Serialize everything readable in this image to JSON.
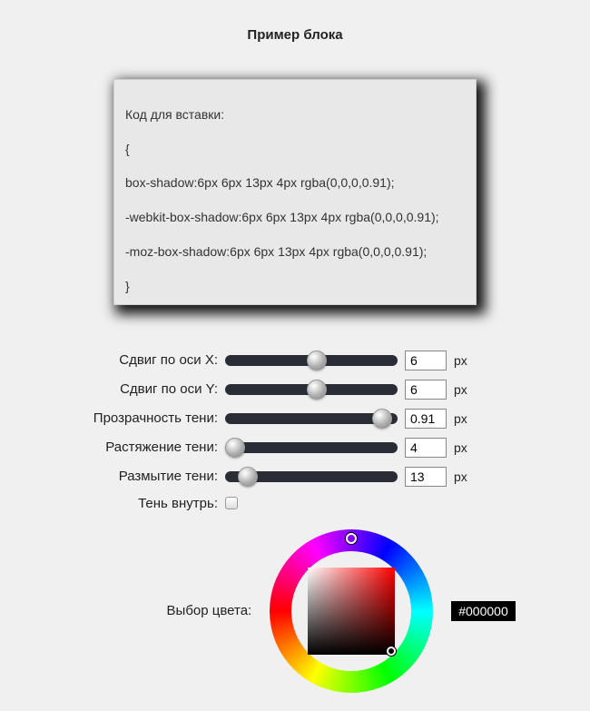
{
  "title": "Пример блока",
  "code": {
    "heading": "Код для вставки:",
    "open_brace": "{",
    "line1": "box-shadow:6px 6px 13px 4px rgba(0,0,0,0.91);",
    "line2": "-webkit-box-shadow:6px 6px 13px 4px rgba(0,0,0,0.91);",
    "line3": "-moz-box-shadow:6px 6px 13px 4px rgba(0,0,0,0.91);",
    "close_brace": "}"
  },
  "sliders": {
    "offset_x": {
      "label": "Сдвиг по оси X:",
      "value": "6",
      "unit": "px",
      "pct": 53
    },
    "offset_y": {
      "label": "Сдвиг по оси Y:",
      "value": "6",
      "unit": "px",
      "pct": 53
    },
    "opacity": {
      "label": "Прозрачность тени:",
      "value": "0.91",
      "unit": "px",
      "pct": 91
    },
    "spread": {
      "label": "Растяжение тени:",
      "value": "4",
      "unit": "px",
      "pct": 6
    },
    "blur": {
      "label": "Размытие тени:",
      "value": "13",
      "unit": "px",
      "pct": 13
    }
  },
  "inset": {
    "label": "Тень внутрь:",
    "checked": false
  },
  "color": {
    "label": "Выбор цвета:",
    "hex": "#000000"
  }
}
